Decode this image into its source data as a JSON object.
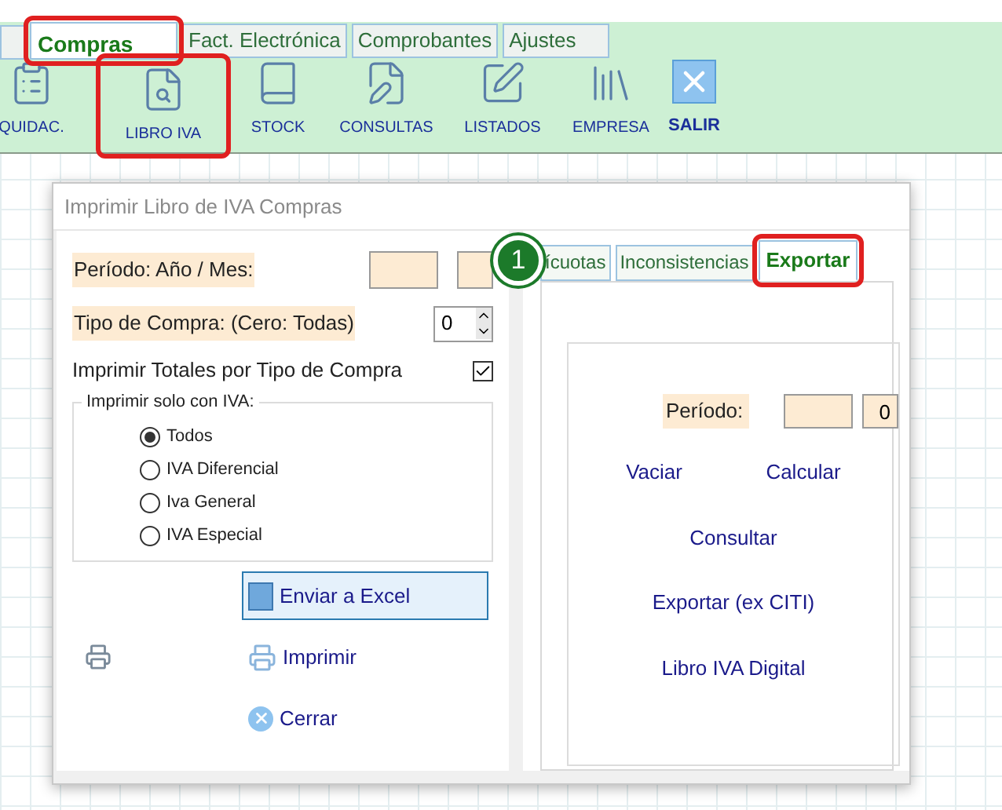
{
  "top_tabs": [
    {
      "label": "Compras",
      "selected": true,
      "highlighted": true
    },
    {
      "label": "Fact. Electrónica",
      "selected": false,
      "highlighted": false
    },
    {
      "label": "Comprobantes",
      "selected": false,
      "highlighted": false
    },
    {
      "label": "Ajustes",
      "selected": false,
      "highlighted": false
    }
  ],
  "toolbar": [
    {
      "label": "QUIDAC.",
      "kind": "checklist",
      "highlighted": false
    },
    {
      "label": "LIBRO IVA",
      "kind": "search-doc",
      "highlighted": true
    },
    {
      "label": "STOCK",
      "kind": "book",
      "highlighted": false
    },
    {
      "label": "CONSULTAS",
      "kind": "doc-pen",
      "highlighted": false
    },
    {
      "label": "LISTADOS",
      "kind": "pen",
      "highlighted": false
    },
    {
      "label": "EMPRESA",
      "kind": "library",
      "highlighted": false
    },
    {
      "label": "SALIR",
      "kind": "close",
      "highlighted": false
    }
  ],
  "dialog": {
    "title": "Imprimir Libro de IVA Compras",
    "period_label": "Período: Año / Mes:",
    "type_label": "Tipo de Compra: (Cero: Todas)",
    "type_value": "0",
    "totals_label": "Imprimir Totales por Tipo de Compra",
    "totals_checked": true,
    "group_title": "Imprimir solo con IVA:",
    "options": [
      {
        "label": "Todos",
        "selected": true
      },
      {
        "label": "IVA Diferencial",
        "selected": false
      },
      {
        "label": "Iva General",
        "selected": false
      },
      {
        "label": "IVA Especial",
        "selected": false
      }
    ],
    "buttons": [
      {
        "label": "Enviar a Excel",
        "kind": "excel",
        "focused": true
      },
      {
        "label": "Imprimir",
        "kind": "print",
        "focused": false
      },
      {
        "label": "Cerrar",
        "kind": "close",
        "focused": false
      }
    ],
    "badge": "1",
    "tabs": [
      {
        "label": "ícuotas",
        "selected": false,
        "highlighted": false
      },
      {
        "label": "Inconsistencias",
        "selected": false,
        "highlighted": false
      },
      {
        "label": "Exportar",
        "selected": true,
        "highlighted": true
      }
    ],
    "export": {
      "period_label": "Período:",
      "period_value": "0",
      "action_rows": [
        [
          "Vaciar",
          "Calcular"
        ],
        [
          "Consultar"
        ],
        [
          "Exportar (ex CITI)"
        ],
        [
          "Libro IVA Digital"
        ]
      ]
    }
  }
}
